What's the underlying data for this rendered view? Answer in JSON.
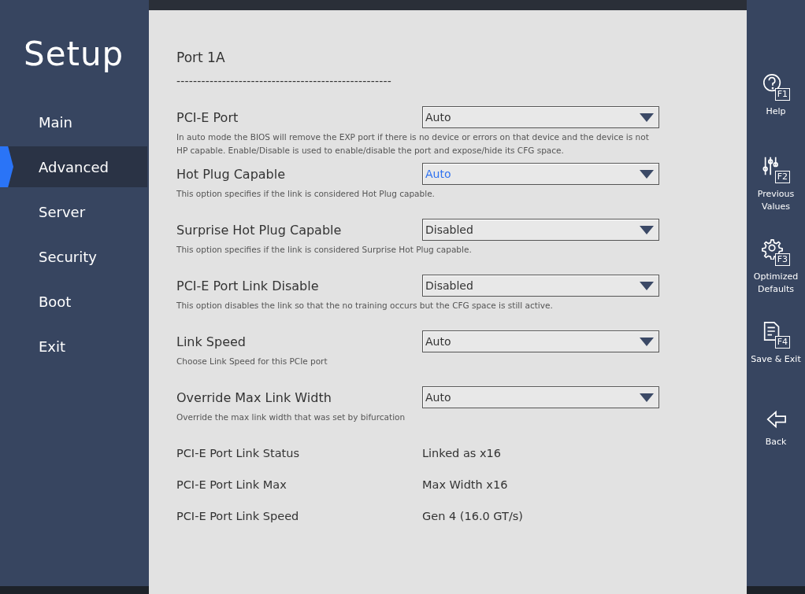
{
  "sidebar": {
    "title": "Setup",
    "items": [
      {
        "label": "Main",
        "selected": false
      },
      {
        "label": "Advanced",
        "selected": true
      },
      {
        "label": "Server",
        "selected": false
      },
      {
        "label": "Security",
        "selected": false
      },
      {
        "label": "Boot",
        "selected": false
      },
      {
        "label": "Exit",
        "selected": false
      }
    ]
  },
  "page": {
    "title": "Port 1A",
    "separator": "----------------------------------------------------",
    "settings": [
      {
        "kind": "select",
        "label": "PCI-E Port",
        "value": "Auto",
        "focused": false,
        "help": "In auto mode the BIOS will remove the EXP port if there is no device or errors on that device and the device is not HP capable.  Enable/Disable is used to enable/disable the port and expose/hide its CFG space."
      },
      {
        "kind": "select",
        "label": "Hot Plug Capable",
        "value": "Auto",
        "focused": true,
        "help": "This option specifies if the link is considered Hot Plug capable."
      },
      {
        "kind": "select",
        "label": "Surprise Hot Plug Capable",
        "value": "Disabled",
        "focused": false,
        "help": "This option specifies if the link is considered Surprise Hot Plug capable."
      },
      {
        "kind": "select",
        "label": "PCI-E Port Link Disable",
        "value": "Disabled",
        "focused": false,
        "help": "This option disables the link so that the no training occurs but the CFG space is still active."
      },
      {
        "kind": "select",
        "label": "Link Speed",
        "value": "Auto",
        "focused": false,
        "help": "Choose Link Speed for this PCIe port"
      },
      {
        "kind": "select",
        "label": "Override Max Link Width",
        "value": "Auto",
        "focused": false,
        "help": "Override the max link width that was set by bifurcation"
      },
      {
        "kind": "info",
        "label": "PCI-E Port Link Status",
        "value": "Linked as x16"
      },
      {
        "kind": "info",
        "label": "PCI-E Port Link Max",
        "value": "Max Width x16"
      },
      {
        "kind": "info",
        "label": "PCI-E Port Link Speed",
        "value": "Gen 4 (16.0 GT/s)"
      }
    ]
  },
  "actions": [
    {
      "kind": "help",
      "key": "F1",
      "label": "Help"
    },
    {
      "kind": "previous",
      "key": "F2",
      "label": "Previous Values"
    },
    {
      "kind": "defaults",
      "key": "F3",
      "label": "Optimized Defaults"
    },
    {
      "kind": "save",
      "key": "F4",
      "label": "Save & Exit"
    },
    {
      "kind": "back",
      "label": "Back"
    }
  ]
}
